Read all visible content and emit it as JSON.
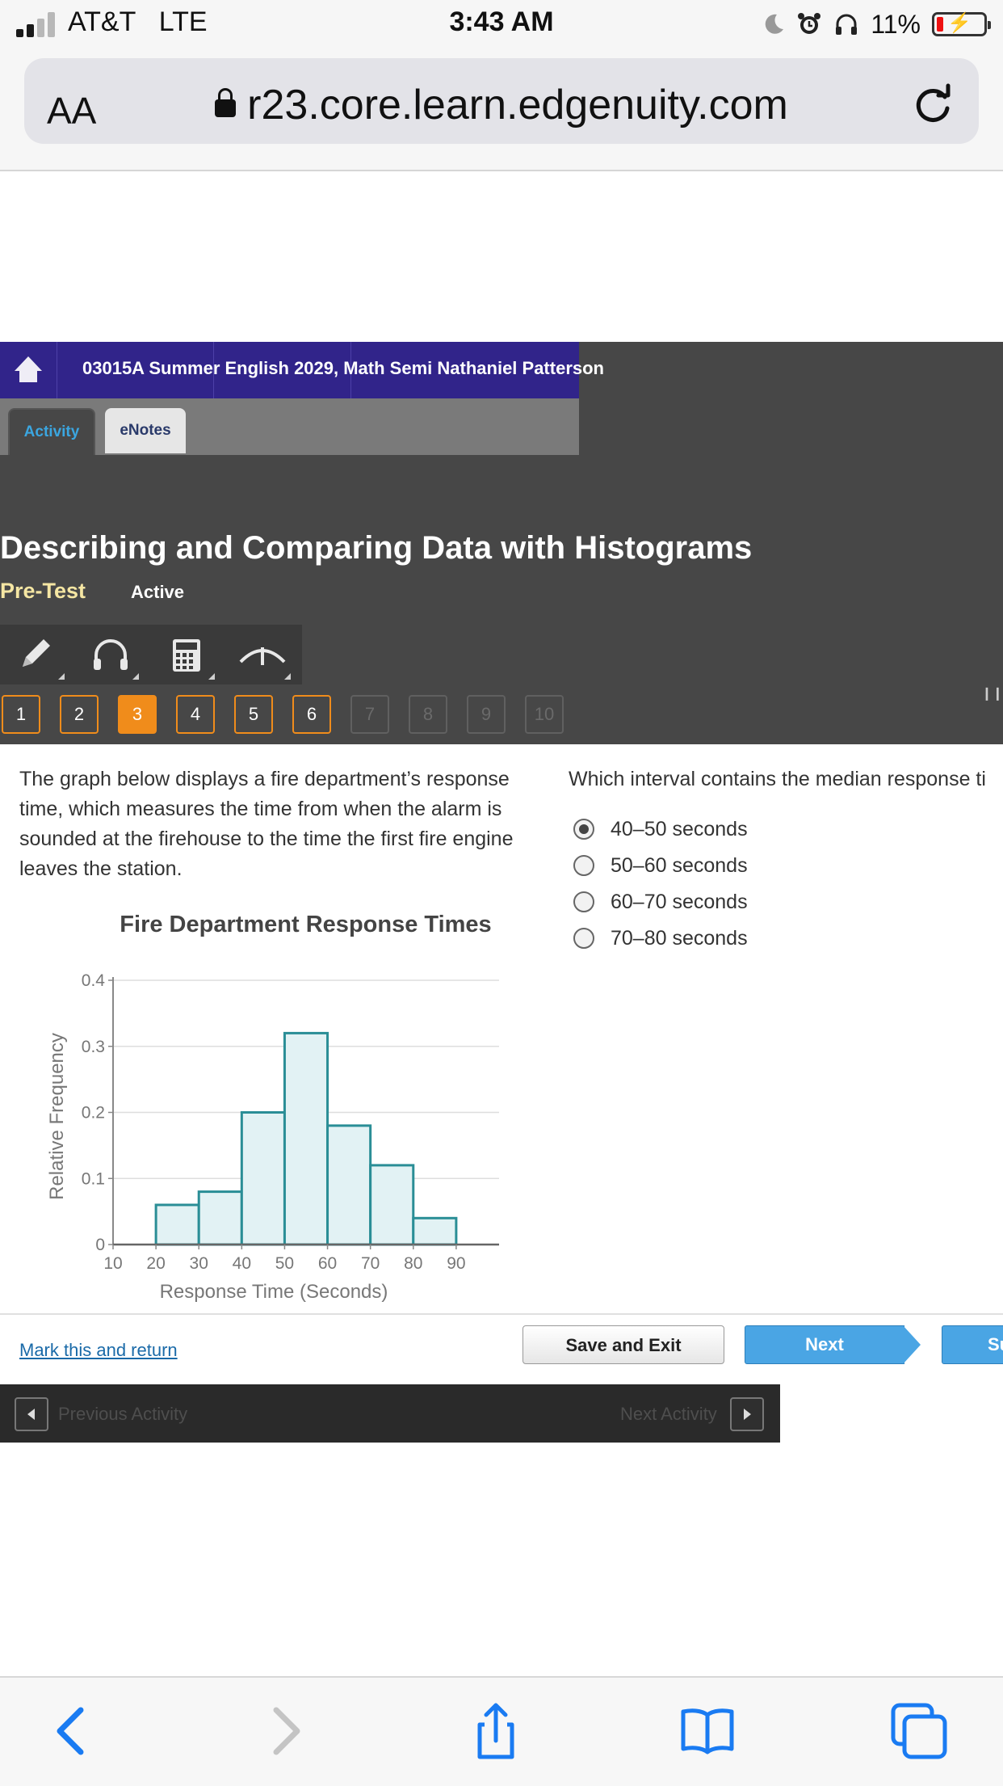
{
  "status_bar": {
    "carrier": "AT&T",
    "network": "LTE",
    "time": "3:43 AM",
    "battery_percent": "11%",
    "signal_bars": 2,
    "icons": [
      "moon-icon",
      "alarm-icon",
      "headphones-icon",
      "battery-charging-icon"
    ]
  },
  "browser": {
    "text_size_label": "AA",
    "url": "r23.core.learn.edgenuity.com",
    "icons": [
      "lock-icon",
      "reload-icon"
    ]
  },
  "course_bar": {
    "course_title": "03015A Summer English 2029, Math Semi",
    "student_name": "Nathaniel Patterson"
  },
  "tabs": [
    {
      "label": "Activity",
      "active": true
    },
    {
      "label": "eNotes",
      "active": false
    }
  ],
  "lesson": {
    "title": "Describing and Comparing Data with Histograms",
    "activity_type": "Pre-Test",
    "status": "Active"
  },
  "tools": [
    "pencil-icon",
    "headphones-icon",
    "calculator-icon",
    "reference-icon"
  ],
  "question_nav": [
    {
      "label": "1",
      "state": "answered"
    },
    {
      "label": "2",
      "state": "answered"
    },
    {
      "label": "3",
      "state": "current"
    },
    {
      "label": "4",
      "state": "answered"
    },
    {
      "label": "5",
      "state": "answered"
    },
    {
      "label": "6",
      "state": "answered"
    },
    {
      "label": "7",
      "state": "locked"
    },
    {
      "label": "8",
      "state": "locked"
    },
    {
      "label": "9",
      "state": "locked"
    },
    {
      "label": "10",
      "state": "locked"
    }
  ],
  "passage": "The graph below displays a fire department’s response time, which measures the time from when the alarm is sounded at the firehouse to the time the first fire engine leaves the station.",
  "chart_data": {
    "type": "bar",
    "title": "Fire Department Response Times",
    "xlabel": "Response Time (Seconds)",
    "ylabel": "Relative Frequency",
    "x_ticks": [
      "10",
      "20",
      "30",
      "40",
      "50",
      "60",
      "70",
      "80",
      "90"
    ],
    "y_ticks": [
      "0",
      "0.1",
      "0.2",
      "0.3",
      "0.4"
    ],
    "bins": [
      [
        20,
        30
      ],
      [
        30,
        40
      ],
      [
        40,
        50
      ],
      [
        50,
        60
      ],
      [
        60,
        70
      ],
      [
        70,
        80
      ],
      [
        80,
        90
      ]
    ],
    "values": [
      0.06,
      0.08,
      0.2,
      0.32,
      0.18,
      0.12,
      0.04
    ],
    "xlim": [
      10,
      100
    ],
    "ylim": [
      0,
      0.4
    ],
    "grid": true,
    "bar_fill": "#e2f2f4",
    "bar_stroke": "#2a8e96"
  },
  "question": {
    "prompt": "Which interval contains the median response ti",
    "options": [
      {
        "label": "40–50 seconds",
        "selected": true
      },
      {
        "label": "50–60 seconds",
        "selected": false
      },
      {
        "label": "60–70 seconds",
        "selected": false
      },
      {
        "label": "70–80 seconds",
        "selected": false
      }
    ]
  },
  "actions": {
    "mark_link": "Mark this and return",
    "save_exit": "Save and Exit",
    "next": "Next",
    "submit": "Su"
  },
  "activity_nav": {
    "previous": "Previous Activity",
    "next": "Next Activity"
  },
  "colors": {
    "course_bar": "#31248a",
    "header_bg": "#474747",
    "accent_orange": "#f08c1b",
    "button_blue": "#4aa5e4",
    "pretest_yellow": "#f5e6a3"
  }
}
